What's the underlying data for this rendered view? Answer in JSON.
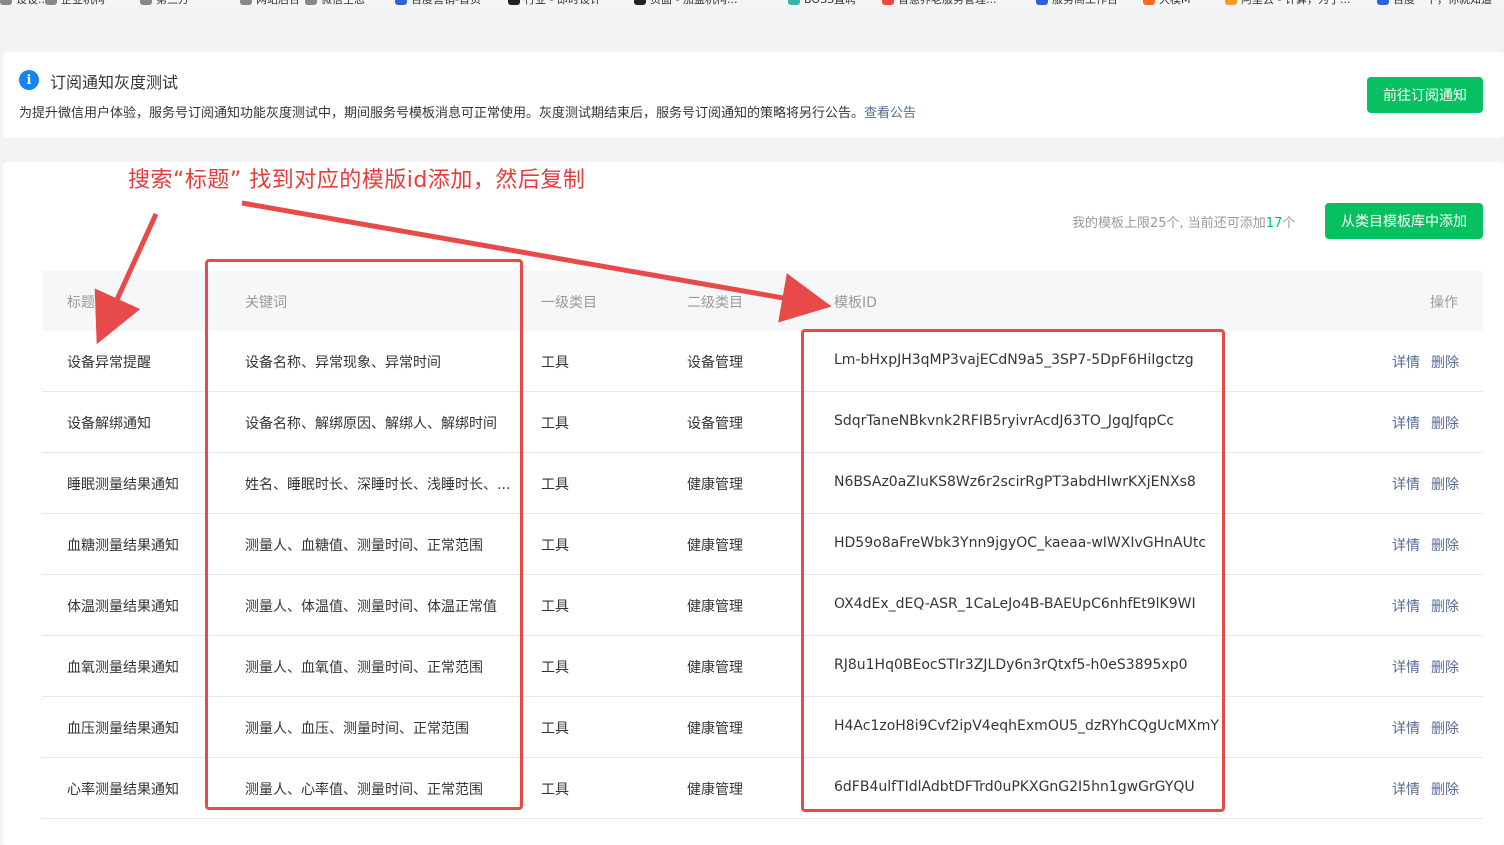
{
  "bookmarks": [
    {
      "label": "设设...",
      "color": "#888888"
    },
    {
      "label": "企业机构",
      "color": "#888888"
    },
    {
      "label": "第三方",
      "color": "#888888"
    },
    {
      "label": "网站后台",
      "color": "#888888"
    },
    {
      "label": "微信生态",
      "color": "#888888"
    },
    {
      "label": "百度营销-首页",
      "color": "#2b63d9"
    },
    {
      "label": "行业 - 即时设计",
      "color": "#222222"
    },
    {
      "label": "页面 - 加盟机构...",
      "color": "#222222"
    },
    {
      "label": "BOSS直聘",
      "color": "#3bb3a6"
    },
    {
      "label": "智慧养老服务管理...",
      "color": "#e84a3b"
    },
    {
      "label": "服务商工作台",
      "color": "#2b63d9"
    },
    {
      "label": "大模M",
      "color": "#f26b21"
    },
    {
      "label": "阿里云 - 计算，为了...",
      "color": "#f59a23"
    },
    {
      "label": "百度一下，你就知道",
      "color": "#2b63d9"
    }
  ],
  "notice": {
    "title": "订阅通知灰度测试",
    "description": "为提升微信用户体验，服务号订阅通知功能灰度测试中，期间服务号模板消息可正常使用。灰度测试期结束后，服务号订阅通知的策略将另行公告。",
    "link_text": "查看公告",
    "button_label": "前往订阅通知"
  },
  "toolbar": {
    "quota_prefix": "我的模板上限25个, 当前还可添加",
    "quota_remaining": "17",
    "quota_suffix": "个",
    "add_button_label": "从类目模板库中添加"
  },
  "annotation": {
    "text": "搜索“标题”  找到对应的模版id添加，然后复制"
  },
  "table": {
    "headers": {
      "title": "标题",
      "keywords": "关键词",
      "category1": "一级类目",
      "category2": "二级类目",
      "template_id": "模板ID",
      "operation": "操作"
    },
    "detail_label": "详情",
    "delete_label": "删除",
    "rows": [
      {
        "title": "设备异常提醒",
        "keywords": "设备名称、异常现象、异常时间",
        "cat1": "工具",
        "cat2": "设备管理",
        "id": "Lm-bHxpJH3qMP3vajECdN9a5_3SP7-5DpF6HiIgctzg"
      },
      {
        "title": "设备解绑通知",
        "keywords": "设备名称、解绑原因、解绑人、解绑时间",
        "cat1": "工具",
        "cat2": "设备管理",
        "id": "SdqrTaneNBkvnk2RFIB5ryivrAcdJ63TO_JgqJfqpCc"
      },
      {
        "title": "睡眠测量结果通知",
        "keywords": "姓名、睡眠时长、深睡时长、浅睡时长、...",
        "cat1": "工具",
        "cat2": "健康管理",
        "id": "N6BSAz0aZIuKS8Wz6r2scirRgPT3abdHIwrKXjENXs8"
      },
      {
        "title": "血糖测量结果通知",
        "keywords": "测量人、血糖值、测量时间、正常范围",
        "cat1": "工具",
        "cat2": "健康管理",
        "id": "HD59o8aFreWbk3Ynn9jgyOC_kaeaa-wIWXIvGHnAUtc"
      },
      {
        "title": "体温测量结果通知",
        "keywords": "测量人、体温值、测量时间、体温正常值",
        "cat1": "工具",
        "cat2": "健康管理",
        "id": "OX4dEx_dEQ-ASR_1CaLeJo4B-BAEUpC6nhfEt9lK9WI"
      },
      {
        "title": "血氧测量结果通知",
        "keywords": "测量人、血氧值、测量时间、正常范围",
        "cat1": "工具",
        "cat2": "健康管理",
        "id": "RJ8u1Hq0BEocSTIr3ZJLDy6n3rQtxf5-h0eS3895xp0"
      },
      {
        "title": "血压测量结果通知",
        "keywords": "测量人、血压、测量时间、正常范围",
        "cat1": "工具",
        "cat2": "健康管理",
        "id": "H4Ac1zoH8i9Cvf2ipV4eqhExmOU5_dzRYhCQgUcMXmY"
      },
      {
        "title": "心率测量结果通知",
        "keywords": "测量人、心率值、测量时间、正常范围",
        "cat1": "工具",
        "cat2": "健康管理",
        "id": "6dFB4ulfTIdlAdbtDFTrd0uPKXGnG2I5hn1gwGrGYQU"
      }
    ]
  },
  "colors": {
    "brand_green": "#07c160",
    "link_blue": "#576b95",
    "annotation_red": "#e84a4a",
    "info_blue": "#1485ee"
  }
}
